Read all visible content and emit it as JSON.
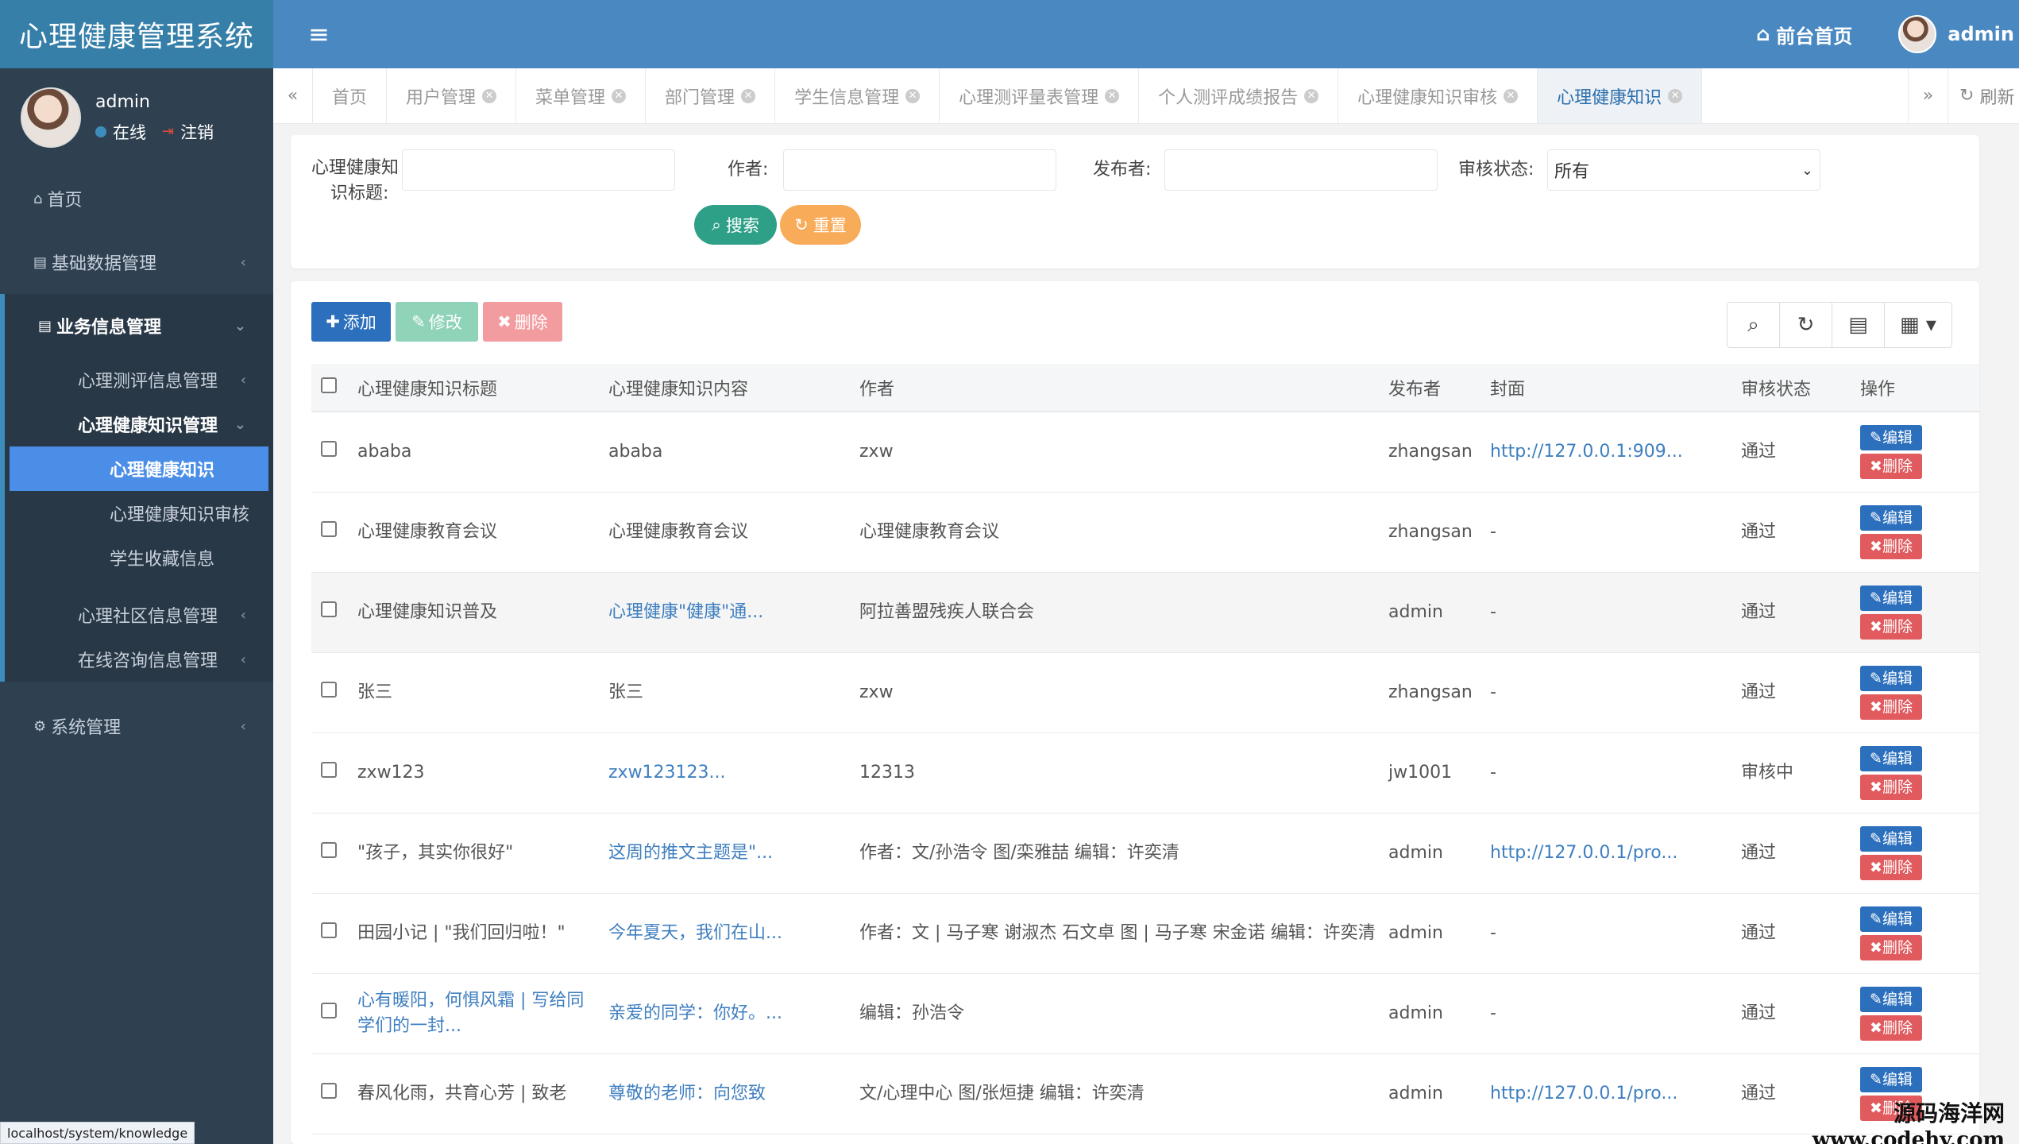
{
  "app": {
    "title": "心理健康管理系统"
  },
  "profile": {
    "name": "admin",
    "status": "在线",
    "logout": "注销"
  },
  "menu": {
    "home": "首页",
    "base_data": "基础数据管理",
    "business": "业务信息管理",
    "eval_info": "心理测评信息管理",
    "knowledge_mgmt": "心理健康知识管理",
    "knowledge": "心理健康知识",
    "knowledge_review": "心理健康知识审核",
    "favorites": "学生收藏信息",
    "community": "心理社区信息管理",
    "consult": "在线咨询信息管理",
    "system": "系统管理"
  },
  "topbar": {
    "front_home": "前台首页",
    "user": "admin"
  },
  "tabs": [
    "首页",
    "用户管理",
    "菜单管理",
    "部门管理",
    "学生信息管理",
    "心理测评量表管理",
    "个人测评成绩报告",
    "心理健康知识审核",
    "心理健康知识"
  ],
  "tabs_refresh": "刷新",
  "search": {
    "title_label_1": "心理健康知",
    "title_label_2": "识标题:",
    "author_label": "作者:",
    "publisher_label": "发布者:",
    "status_label": "审核状态:",
    "status_value": "所有",
    "search_btn": "搜索",
    "reset_btn": "重置"
  },
  "toolbar": {
    "add": "添加",
    "edit": "修改",
    "delete": "删除"
  },
  "table": {
    "headers": [
      "心理健康知识标题",
      "心理健康知识内容",
      "作者",
      "发布者",
      "封面",
      "审核状态",
      "操作"
    ],
    "op_edit": "编辑",
    "op_delete": "删除",
    "rows": [
      {
        "title": "ababa",
        "content": "ababa",
        "author": "zxw",
        "publisher": "zhangsan",
        "cover": "http://127.0.0.1:909...",
        "status": "通过"
      },
      {
        "title": "心理健康教育会议",
        "content": "心理健康教育会议",
        "author": "心理健康教育会议",
        "publisher": "zhangsan",
        "cover": "-",
        "status": "通过"
      },
      {
        "title": "心理健康知识普及",
        "content": "心理健康\"健康\"通...",
        "author": "阿拉善盟残疾人联合会",
        "publisher": "admin",
        "cover": "-",
        "status": "通过"
      },
      {
        "title": "张三",
        "content": "张三",
        "author": "zxw",
        "publisher": "zhangsan",
        "cover": "-",
        "status": "通过"
      },
      {
        "title": "zxw123",
        "content": "zxw123123...",
        "author": "12313",
        "publisher": "jw1001",
        "cover": "-",
        "status": "审核中"
      },
      {
        "title": "\"孩子，其实你很好\"",
        "content": "这周的推文主题是\"...",
        "author": "作者：文/孙浩令 图/栾雅喆 编辑：许奕清",
        "publisher": "admin",
        "cover": "http://127.0.0.1/pro...",
        "status": "通过"
      },
      {
        "title": "田园小记 | \"我们回归啦！\"",
        "content": "今年夏天，我们在山...",
        "author": "作者：文 | 马子寒 谢淑杰 石文卓 图 | 马子寒 宋金诺 编辑：许奕清",
        "publisher": "admin",
        "cover": "-",
        "status": "通过"
      },
      {
        "title": "心有暖阳，何惧风霜 | 写给同学们的一封...",
        "content": "亲爱的同学：你好。...",
        "author": "编辑：孙浩令",
        "publisher": "admin",
        "cover": "-",
        "status": "通过"
      },
      {
        "title": "春风化雨，共育心芳 | 致老",
        "content": "尊敬的老师：向您致",
        "author": "文/心理中心 图/张烜捷 编辑：许奕清",
        "publisher": "admin",
        "cover": "http://127.0.0.1/pro...",
        "status": "通过"
      }
    ]
  },
  "statusbar": "localhost/system/knowledge",
  "watermark": {
    "line1": "源码海洋网",
    "line2": "www.codehy.com"
  }
}
